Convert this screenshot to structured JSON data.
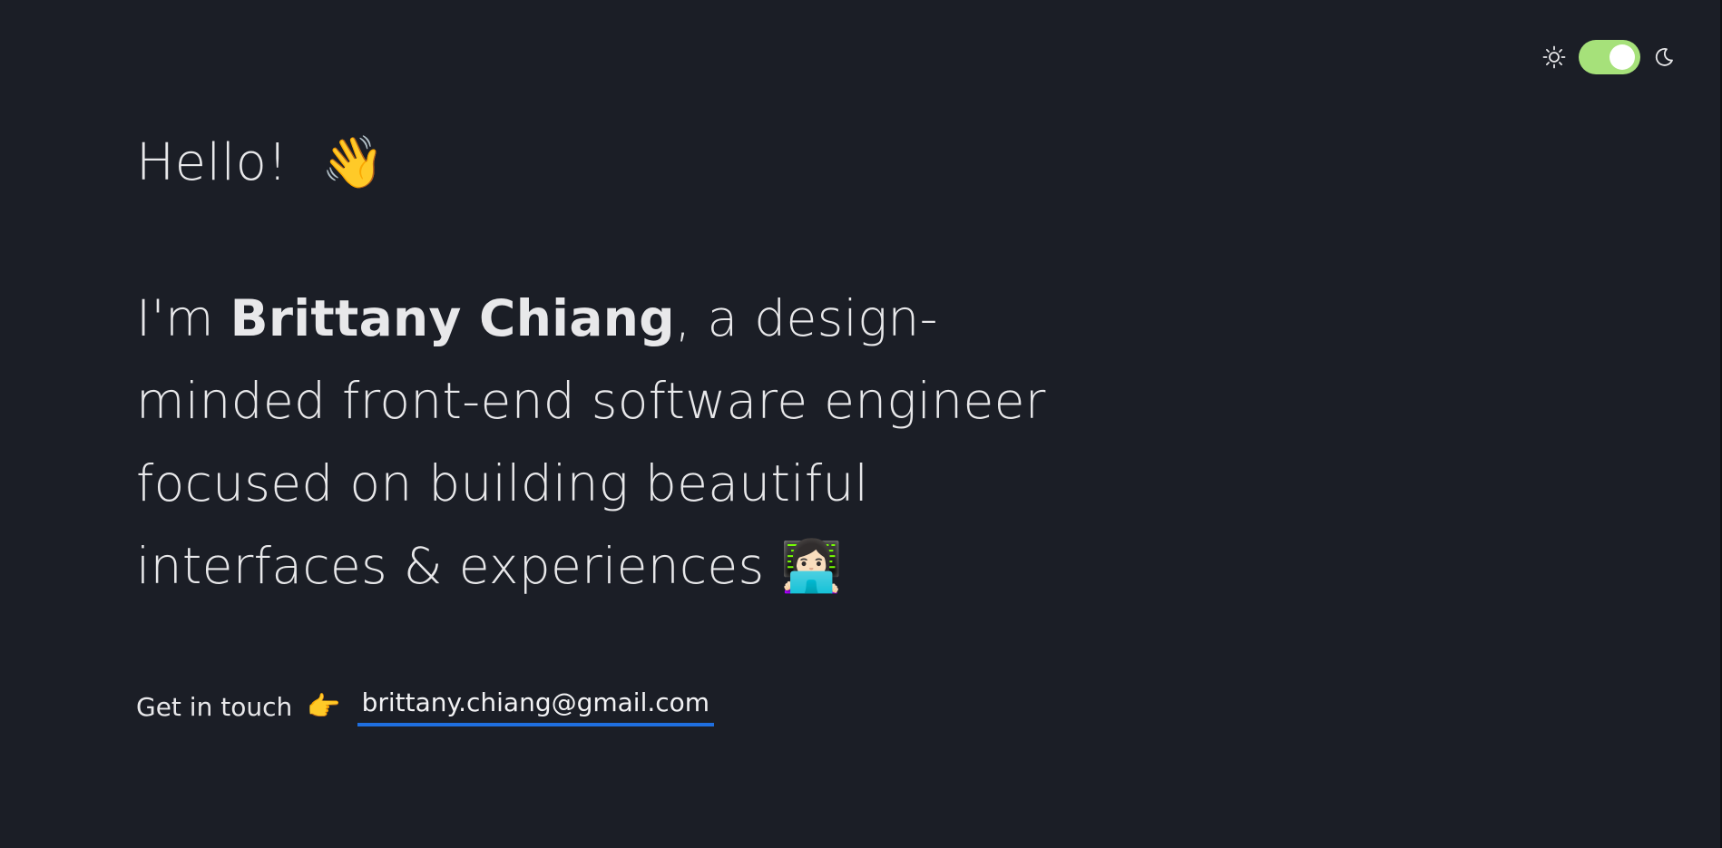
{
  "theme": {
    "mode": "dark",
    "sun_icon": "sun-icon",
    "moon_icon": "moon-icon",
    "toggle_color": "#a6e17a",
    "background": "#1b1e26"
  },
  "hero": {
    "greeting": "Hello!",
    "greeting_emoji": "👋",
    "intro_prefix": "I'm ",
    "name": "Brittany Chiang",
    "intro_suffix": ", a design-minded front-end software engineer focused on building beautiful interfaces & experiences",
    "intro_emoji": "👩🏻‍💻"
  },
  "contact": {
    "label": "Get in touch",
    "emoji": "👉",
    "email": "brittany.chiang@gmail.com",
    "link_underline_color": "#1f6fe0"
  }
}
